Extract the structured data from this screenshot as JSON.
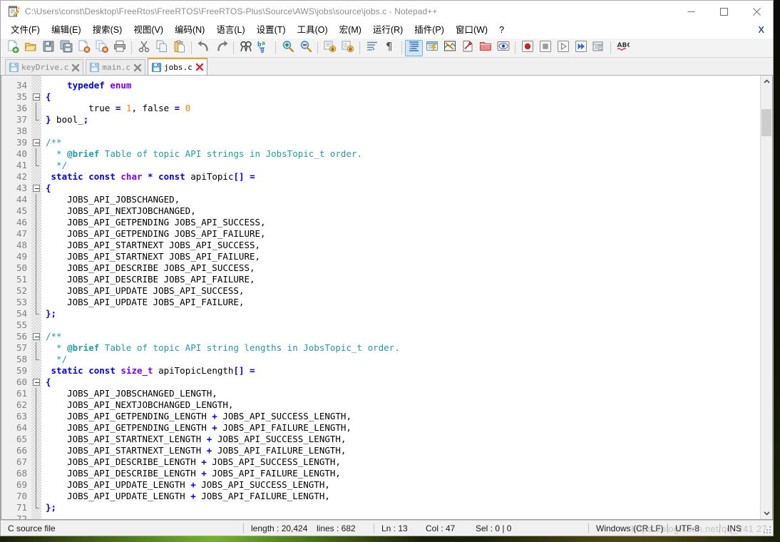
{
  "window": {
    "title": "C:\\Users\\const\\Desktop\\FreeRtos\\FreeRTOS\\FreeRTOS-Plus\\Source\\AWS\\jobs\\source\\jobs.c - Notepad++",
    "minimize_label": "—",
    "maximize_label": "☐",
    "close_label": "✕",
    "doc_close_label": "X"
  },
  "menu": {
    "items": [
      {
        "label": "文件(F)"
      },
      {
        "label": "编辑(E)"
      },
      {
        "label": "搜索(S)"
      },
      {
        "label": "视图(V)"
      },
      {
        "label": "编码(N)"
      },
      {
        "label": "语言(L)"
      },
      {
        "label": "设置(T)"
      },
      {
        "label": "工具(O)"
      },
      {
        "label": "宏(M)"
      },
      {
        "label": "运行(R)"
      },
      {
        "label": "插件(P)"
      },
      {
        "label": "窗口(W)"
      },
      {
        "label": "?"
      }
    ]
  },
  "toolbar": {
    "groups": [
      {
        "buttons": [
          {
            "icon": "new-file-icon",
            "title": "新建"
          },
          {
            "icon": "open-file-icon",
            "title": "打开"
          },
          {
            "icon": "save-icon",
            "title": "保存"
          },
          {
            "icon": "save-all-icon",
            "title": "全部保存"
          },
          {
            "icon": "close-file-icon",
            "title": "关闭"
          },
          {
            "icon": "close-all-icon",
            "title": "全部关闭"
          },
          {
            "icon": "print-icon",
            "title": "打印"
          }
        ]
      },
      {
        "buttons": [
          {
            "icon": "cut-icon",
            "title": "剪切"
          },
          {
            "icon": "copy-icon",
            "title": "复制"
          },
          {
            "icon": "paste-icon",
            "title": "粘贴"
          }
        ]
      },
      {
        "buttons": [
          {
            "icon": "undo-icon",
            "title": "撤销"
          },
          {
            "icon": "redo-icon",
            "title": "重做"
          }
        ]
      },
      {
        "buttons": [
          {
            "icon": "find-icon",
            "title": "查找"
          },
          {
            "icon": "replace-icon",
            "title": "替换"
          }
        ]
      },
      {
        "buttons": [
          {
            "icon": "zoom-in-icon",
            "title": "放大"
          },
          {
            "icon": "zoom-out-icon",
            "title": "缩小"
          }
        ]
      },
      {
        "buttons": [
          {
            "icon": "sync-scroll-v-icon",
            "title": "同步垂直滚动"
          },
          {
            "icon": "sync-scroll-h-icon",
            "title": "同步水平滚动"
          }
        ]
      },
      {
        "buttons": [
          {
            "icon": "word-wrap-icon",
            "title": "自动换行"
          },
          {
            "icon": "show-symbol-icon",
            "title": "显示符号"
          }
        ]
      },
      {
        "buttons": [
          {
            "icon": "indent-guide-icon",
            "title": "显示缩进引导线",
            "active": true
          },
          {
            "icon": "udl-dialog-icon",
            "title": "用户自定义语言"
          },
          {
            "icon": "doc-map-icon",
            "title": "文档地图"
          },
          {
            "icon": "function-list-icon",
            "title": "函数列表"
          },
          {
            "icon": "folder-workspace-icon",
            "title": "文件浏览"
          },
          {
            "icon": "monitor-icon",
            "title": "监视"
          }
        ]
      },
      {
        "buttons": [
          {
            "icon": "record-macro-icon",
            "title": "开始录制宏"
          },
          {
            "icon": "stop-macro-icon",
            "title": "停止录制宏"
          },
          {
            "icon": "play-macro-icon",
            "title": "播放宏"
          },
          {
            "icon": "play-multi-icon",
            "title": "多次运行宏"
          },
          {
            "icon": "save-macro-icon",
            "title": "保存当前录制的宏"
          }
        ]
      },
      {
        "buttons": [
          {
            "icon": "spellcheck-abc-icon",
            "title": "ABC 拼写检查"
          }
        ]
      }
    ]
  },
  "tabs": [
    {
      "label": "keyDrive.c",
      "active": false,
      "saved": true
    },
    {
      "label": "main.c",
      "active": false,
      "saved": true
    },
    {
      "label": "jobs.c",
      "active": true,
      "saved": true
    }
  ],
  "editor": {
    "first_line": 34,
    "lines": [
      {
        "n": 34,
        "fold": "none",
        "tokens": [
          {
            "t": "    ",
            "c": "id"
          },
          {
            "t": "typedef",
            "c": "kw"
          },
          {
            "t": " ",
            "c": "id"
          },
          {
            "t": "enum",
            "c": "type"
          }
        ]
      },
      {
        "n": 35,
        "fold": "start",
        "tokens": [
          {
            "t": "{",
            "c": "br"
          }
        ]
      },
      {
        "n": 36,
        "fold": "line",
        "tokens": [
          {
            "t": "        true ",
            "c": "id"
          },
          {
            "t": "=",
            "c": "op"
          },
          {
            "t": " ",
            "c": "id"
          },
          {
            "t": "1",
            "c": "num"
          },
          {
            "t": ", false ",
            "c": "id"
          },
          {
            "t": "=",
            "c": "op"
          },
          {
            "t": " ",
            "c": "id"
          },
          {
            "t": "0",
            "c": "num"
          }
        ]
      },
      {
        "n": 37,
        "fold": "end",
        "tokens": [
          {
            "t": "}",
            "c": "br"
          },
          {
            "t": " bool_",
            "c": "id"
          },
          {
            "t": ";",
            "c": "op"
          }
        ]
      },
      {
        "n": 38,
        "fold": "none",
        "tokens": [
          {
            "t": "",
            "c": "id"
          }
        ]
      },
      {
        "n": 39,
        "fold": "start",
        "tokens": [
          {
            "t": "/**",
            "c": "cmt"
          }
        ]
      },
      {
        "n": 40,
        "fold": "line",
        "tokens": [
          {
            "t": "  * ",
            "c": "cmt"
          },
          {
            "t": "@brief",
            "c": "cmtb"
          },
          {
            "t": " Table of topic API strings in ",
            "c": "cmt"
          },
          {
            "t": "JobsTopic_t",
            "c": "cmt"
          },
          {
            "t": " order.",
            "c": "cmt"
          }
        ]
      },
      {
        "n": 41,
        "fold": "end",
        "tokens": [
          {
            "t": "  */",
            "c": "cmt"
          }
        ]
      },
      {
        "n": 42,
        "fold": "none",
        "tokens": [
          {
            "t": " ",
            "c": "id"
          },
          {
            "t": "static",
            "c": "kw"
          },
          {
            "t": " ",
            "c": "id"
          },
          {
            "t": "const",
            "c": "kw"
          },
          {
            "t": " ",
            "c": "id"
          },
          {
            "t": "char",
            "c": "type"
          },
          {
            "t": " ",
            "c": "id"
          },
          {
            "t": "*",
            "c": "op"
          },
          {
            "t": " ",
            "c": "id"
          },
          {
            "t": "const",
            "c": "kw"
          },
          {
            "t": " apiTopic",
            "c": "id"
          },
          {
            "t": "[]",
            "c": "op"
          },
          {
            "t": " ",
            "c": "id"
          },
          {
            "t": "=",
            "c": "op"
          }
        ]
      },
      {
        "n": 43,
        "fold": "start",
        "tokens": [
          {
            "t": "{",
            "c": "br"
          }
        ]
      },
      {
        "n": 44,
        "fold": "line",
        "tokens": [
          {
            "t": "    JOBS_API_JOBSCHANGED,",
            "c": "id"
          }
        ]
      },
      {
        "n": 45,
        "fold": "line",
        "tokens": [
          {
            "t": "    JOBS_API_NEXTJOBCHANGED,",
            "c": "id"
          }
        ]
      },
      {
        "n": 46,
        "fold": "line",
        "tokens": [
          {
            "t": "    JOBS_API_GETPENDING JOBS_API_SUCCESS,",
            "c": "id"
          }
        ]
      },
      {
        "n": 47,
        "fold": "line",
        "tokens": [
          {
            "t": "    JOBS_API_GETPENDING JOBS_API_FAILURE,",
            "c": "id"
          }
        ]
      },
      {
        "n": 48,
        "fold": "line",
        "tokens": [
          {
            "t": "    JOBS_API_STARTNEXT JOBS_API_SUCCESS,",
            "c": "id"
          }
        ]
      },
      {
        "n": 49,
        "fold": "line",
        "tokens": [
          {
            "t": "    JOBS_API_STARTNEXT JOBS_API_FAILURE,",
            "c": "id"
          }
        ]
      },
      {
        "n": 50,
        "fold": "line",
        "tokens": [
          {
            "t": "    JOBS_API_DESCRIBE JOBS_API_SUCCESS,",
            "c": "id"
          }
        ]
      },
      {
        "n": 51,
        "fold": "line",
        "tokens": [
          {
            "t": "    JOBS_API_DESCRIBE JOBS_API_FAILURE,",
            "c": "id"
          }
        ]
      },
      {
        "n": 52,
        "fold": "line",
        "tokens": [
          {
            "t": "    JOBS_API_UPDATE JOBS_API_SUCCESS,",
            "c": "id"
          }
        ]
      },
      {
        "n": 53,
        "fold": "line",
        "tokens": [
          {
            "t": "    JOBS_API_UPDATE JOBS_API_FAILURE,",
            "c": "id"
          }
        ]
      },
      {
        "n": 54,
        "fold": "end",
        "tokens": [
          {
            "t": "}",
            "c": "br"
          },
          {
            "t": ";",
            "c": "op"
          }
        ]
      },
      {
        "n": 55,
        "fold": "none",
        "tokens": [
          {
            "t": "",
            "c": "id"
          }
        ]
      },
      {
        "n": 56,
        "fold": "start",
        "tokens": [
          {
            "t": "/**",
            "c": "cmt"
          }
        ]
      },
      {
        "n": 57,
        "fold": "line",
        "tokens": [
          {
            "t": "  * ",
            "c": "cmt"
          },
          {
            "t": "@brief",
            "c": "cmtb"
          },
          {
            "t": " Table of topic API string lengths in ",
            "c": "cmt"
          },
          {
            "t": "JobsTopic_t",
            "c": "cmt"
          },
          {
            "t": " order.",
            "c": "cmt"
          }
        ]
      },
      {
        "n": 58,
        "fold": "end",
        "tokens": [
          {
            "t": "  */",
            "c": "cmt"
          }
        ]
      },
      {
        "n": 59,
        "fold": "none",
        "tokens": [
          {
            "t": " ",
            "c": "id"
          },
          {
            "t": "static",
            "c": "kw"
          },
          {
            "t": " ",
            "c": "id"
          },
          {
            "t": "const",
            "c": "kw"
          },
          {
            "t": " ",
            "c": "id"
          },
          {
            "t": "size_t",
            "c": "type"
          },
          {
            "t": " apiTopicLength",
            "c": "id"
          },
          {
            "t": "[]",
            "c": "op"
          },
          {
            "t": " ",
            "c": "id"
          },
          {
            "t": "=",
            "c": "op"
          }
        ]
      },
      {
        "n": 60,
        "fold": "start",
        "tokens": [
          {
            "t": "{",
            "c": "br"
          }
        ]
      },
      {
        "n": 61,
        "fold": "line",
        "tokens": [
          {
            "t": "    JOBS_API_JOBSCHANGED_LENGTH,",
            "c": "id"
          }
        ]
      },
      {
        "n": 62,
        "fold": "line",
        "tokens": [
          {
            "t": "    JOBS_API_NEXTJOBCHANGED_LENGTH,",
            "c": "id"
          }
        ]
      },
      {
        "n": 63,
        "fold": "line",
        "tokens": [
          {
            "t": "    JOBS_API_GETPENDING_LENGTH ",
            "c": "id"
          },
          {
            "t": "+",
            "c": "op"
          },
          {
            "t": " JOBS_API_SUCCESS_LENGTH,",
            "c": "id"
          }
        ]
      },
      {
        "n": 64,
        "fold": "line",
        "tokens": [
          {
            "t": "    JOBS_API_GETPENDING_LENGTH ",
            "c": "id"
          },
          {
            "t": "+",
            "c": "op"
          },
          {
            "t": " JOBS_API_FAILURE_LENGTH,",
            "c": "id"
          }
        ]
      },
      {
        "n": 65,
        "fold": "line",
        "tokens": [
          {
            "t": "    JOBS_API_STARTNEXT_LENGTH ",
            "c": "id"
          },
          {
            "t": "+",
            "c": "op"
          },
          {
            "t": " JOBS_API_SUCCESS_LENGTH,",
            "c": "id"
          }
        ]
      },
      {
        "n": 66,
        "fold": "line",
        "tokens": [
          {
            "t": "    JOBS_API_STARTNEXT_LENGTH ",
            "c": "id"
          },
          {
            "t": "+",
            "c": "op"
          },
          {
            "t": " JOBS_API_FAILURE_LENGTH,",
            "c": "id"
          }
        ]
      },
      {
        "n": 67,
        "fold": "line",
        "tokens": [
          {
            "t": "    JOBS_API_DESCRIBE_LENGTH ",
            "c": "id"
          },
          {
            "t": "+",
            "c": "op"
          },
          {
            "t": " JOBS_API_SUCCESS_LENGTH,",
            "c": "id"
          }
        ]
      },
      {
        "n": 68,
        "fold": "line",
        "tokens": [
          {
            "t": "    JOBS_API_DESCRIBE_LENGTH ",
            "c": "id"
          },
          {
            "t": "+",
            "c": "op"
          },
          {
            "t": " JOBS_API_FAILURE_LENGTH,",
            "c": "id"
          }
        ]
      },
      {
        "n": 69,
        "fold": "line",
        "tokens": [
          {
            "t": "    JOBS_API_UPDATE_LENGTH ",
            "c": "id"
          },
          {
            "t": "+",
            "c": "op"
          },
          {
            "t": " JOBS_API_SUCCESS_LENGTH,",
            "c": "id"
          }
        ]
      },
      {
        "n": 70,
        "fold": "line",
        "tokens": [
          {
            "t": "    JOBS_API_UPDATE_LENGTH ",
            "c": "id"
          },
          {
            "t": "+",
            "c": "op"
          },
          {
            "t": " JOBS_API_FAILURE_LENGTH,",
            "c": "id"
          }
        ]
      },
      {
        "n": 71,
        "fold": "end",
        "tokens": [
          {
            "t": "}",
            "c": "br"
          },
          {
            "t": ";",
            "c": "op"
          }
        ]
      },
      {
        "n": 72,
        "fold": "none",
        "tokens": [
          {
            "t": "",
            "c": "id"
          }
        ]
      }
    ]
  },
  "statusbar": {
    "file_type": "C source file",
    "length": "length : 20,424",
    "lines": "lines : 682",
    "ln": "Ln : 13",
    "col": "Col : 47",
    "sel": "Sel : 0 | 0",
    "eol": "Windows (CR LF)",
    "encoding": "UTF-8",
    "mode": "INS"
  },
  "watermark": "https://blog.csdn.net/qq_241   27",
  "colors": {
    "keyword": "#0000ff",
    "type": "#8000ff",
    "number": "#ff8000",
    "comment": "#1f9ca8",
    "active_tab_accent": "#f0a030",
    "toolbar_active": "#cfe6fb"
  }
}
